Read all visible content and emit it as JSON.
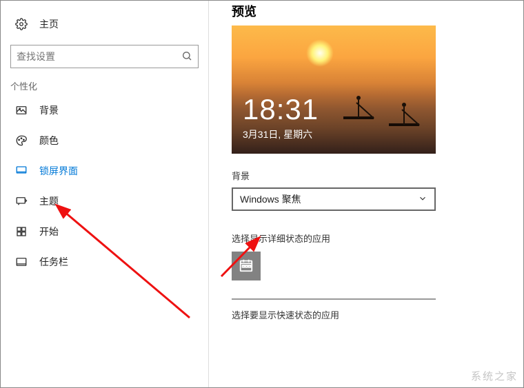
{
  "sidebar": {
    "home": "主页",
    "search_placeholder": "查找设置",
    "group": "个性化",
    "items": [
      {
        "label": "背景"
      },
      {
        "label": "颜色"
      },
      {
        "label": "锁屏界面",
        "active": true
      },
      {
        "label": "主题"
      },
      {
        "label": "开始"
      },
      {
        "label": "任务栏"
      }
    ]
  },
  "main": {
    "page_title": "预览",
    "preview": {
      "time": "18:31",
      "date": "3月31日, 星期六"
    },
    "bg_label": "背景",
    "bg_dropdown_value": "Windows 聚焦",
    "detail_label": "选择显示详细状态的应用",
    "quick_label": "选择要显示快速状态的应用"
  },
  "watermark": "系统之家"
}
